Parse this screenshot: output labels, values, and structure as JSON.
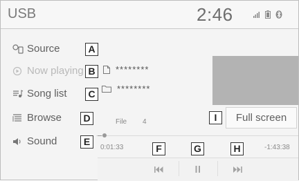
{
  "header": {
    "title": "USB",
    "clock": "2:46",
    "status_icons": [
      "signal-bars-icon",
      "battery-icon",
      "bluetooth-icon"
    ]
  },
  "sidebar": {
    "items": [
      {
        "label": "Source",
        "icon": "source-icon",
        "callout": "A",
        "state": "normal"
      },
      {
        "label": "Now playing",
        "icon": "play-circle-icon",
        "callout": "B",
        "state": "dimmed"
      },
      {
        "label": "Song list",
        "icon": "song-list-icon",
        "callout": "C",
        "state": "normal"
      },
      {
        "label": "Browse",
        "icon": "browse-list-icon",
        "callout": "D",
        "state": "normal"
      },
      {
        "label": "Sound",
        "icon": "speaker-icon",
        "callout": "E",
        "state": "normal"
      }
    ]
  },
  "track": {
    "title": "********",
    "folder": "********",
    "file_label": "File",
    "file_number": "4"
  },
  "fullscreen": {
    "label": "Full screen",
    "callout": "I"
  },
  "playback": {
    "elapsed": "0:01:33",
    "remaining": "-1:43:38",
    "progress_fraction": 0.015
  },
  "controls": {
    "prev_icon": "skip-previous-icon",
    "pause_icon": "pause-icon",
    "next_icon": "skip-next-icon",
    "callouts": [
      "F",
      "G",
      "H"
    ]
  },
  "colors": {
    "text": "#5f5f5f",
    "dim_text": "#b9b9b9",
    "artwork": "#b3b3b3",
    "background": "#f4f4f4"
  }
}
